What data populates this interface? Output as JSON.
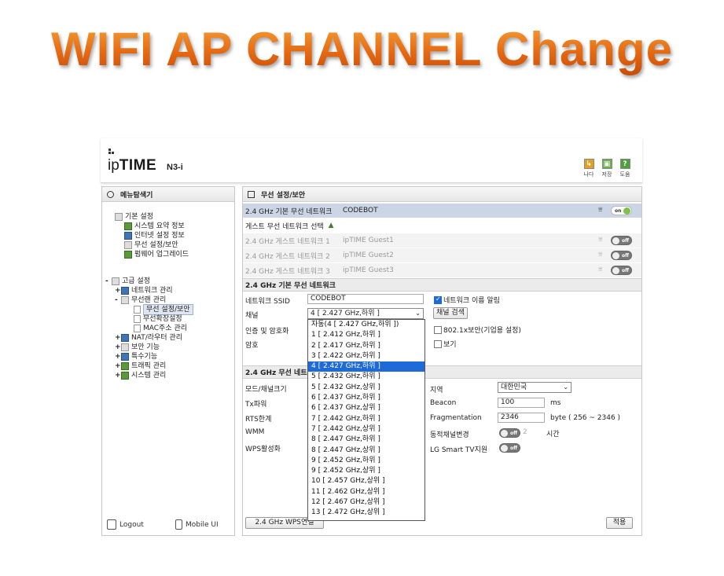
{
  "title": "WIFI AP CHANNEL Change",
  "brand": {
    "logo_ip": "ip",
    "logo_time": "TIME",
    "model": "N3-i"
  },
  "top_icons": [
    {
      "name": "exit-icon",
      "label": "나다",
      "color": "#e0a020"
    },
    {
      "name": "save-icon",
      "label": "저장",
      "color": "#6ab04c"
    },
    {
      "name": "help-icon",
      "label": "도움",
      "color": "#4ea03a"
    }
  ],
  "sidebar": {
    "title": "메뉴탐색기",
    "basic": {
      "label": "기본 설정",
      "items": [
        "시스템 요약 정보",
        "인터넷 설정 정보",
        "무선 설정/보안",
        "펌웨어 업그레이드"
      ]
    },
    "advanced": {
      "label": "고급 설정",
      "items": [
        {
          "pm": "+",
          "label": "네트워크 관리"
        },
        {
          "pm": "-",
          "label": "무선랜 관리"
        },
        {
          "pm": "",
          "label": "무선 설정/보안"
        },
        {
          "pm": "",
          "label": "무선확장설정"
        },
        {
          "pm": "",
          "label": "MAC주소 관리"
        },
        {
          "pm": "+",
          "label": "NAT/라우터 관리"
        },
        {
          "pm": "+",
          "label": "보안 기능"
        },
        {
          "pm": "+",
          "label": "특수기능"
        },
        {
          "pm": "+",
          "label": "트래픽 관리"
        },
        {
          "pm": "+",
          "label": "시스템 관리"
        }
      ]
    },
    "logout": "Logout",
    "mobile": "Mobile UI"
  },
  "main": {
    "title": "무선 설정/보안",
    "network_row": {
      "label": "2.4 GHz 기본 무선 네트워크",
      "value": "CODEBOT",
      "toggle": "on"
    },
    "guest_select": "게스트 무선 네트워크 선택",
    "guests": [
      {
        "label": "2.4 GHz 게스트 네트워크 1",
        "value": "ipTIME Guest1",
        "toggle": "off"
      },
      {
        "label": "2.4 GHz 게스트 네트워크 2",
        "value": "ipTIME Guest2",
        "toggle": "off"
      },
      {
        "label": "2.4 GHz 게스트 네트워크 3",
        "value": "ipTIME Guest3",
        "toggle": "off"
      }
    ],
    "basic_section": {
      "title": "2.4 GHz 기본 무선 네트워크",
      "ssid_label": "네트워크 SSID",
      "ssid_value": "CODEBOT",
      "broadcast_label": "네트워크 이름 알림",
      "channel_label": "채널",
      "channel_value": "4 [ 2.427 GHz,하위 ]",
      "channel_search": "채널 검색",
      "auth_label": "인증 및 암호화",
      "auth_8021x": "802.1x보안(기업용 설정)",
      "password_label": "암호",
      "show_label": "보기"
    },
    "advanced_section": {
      "title": "2.4 GHz 무선 네트",
      "mode_label": "모드/채널크기",
      "tx_label": "Tx파워",
      "rts_label": "RTS한계",
      "wmm_label": "WMM",
      "wps_label": "WPS활성화",
      "region_label": "지역",
      "region_value": "대한민국",
      "beacon_label": "Beacon",
      "beacon_value": "100",
      "beacon_unit": "ms",
      "frag_label": "Fragmentation",
      "frag_value": "2346",
      "frag_unit": "byte ( 256 ~ 2346 )",
      "dyn_label": "동적채널변경",
      "dyn_value": "2",
      "dyn_unit": "시간",
      "lg_label": "LG Smart TV지원"
    },
    "channel_options": [
      "자동(4 [ 2.427 GHz,하위 ])",
      "1 [ 2.412 GHz,하위 ]",
      "2 [ 2.417 GHz,하위 ]",
      "3 [ 2.422 GHz,하위 ]",
      "4 [ 2.427 GHz,하위 ]",
      "5 [ 2.432 GHz,하위 ]",
      "5 [ 2.432 GHz,상위 ]",
      "6 [ 2.437 GHz,하위 ]",
      "6 [ 2.437 GHz,상위 ]",
      "7 [ 2.442 GHz,하위 ]",
      "7 [ 2.442 GHz,상위 ]",
      "8 [ 2.447 GHz,하위 ]",
      "8 [ 2.447 GHz,상위 ]",
      "9 [ 2.452 GHz,하위 ]",
      "9 [ 2.452 GHz,상위 ]",
      "10 [ 2.457 GHz,상위 ]",
      "11 [ 2.462 GHz,상위 ]",
      "12 [ 2.467 GHz,상위 ]",
      "13 [ 2.472 GHz,상위 ]"
    ],
    "highlighted_option": 4,
    "wps_button": "2.4 GHz WPS연결",
    "apply_button": "적용",
    "toggle_on": "on",
    "toggle_off": "off"
  }
}
